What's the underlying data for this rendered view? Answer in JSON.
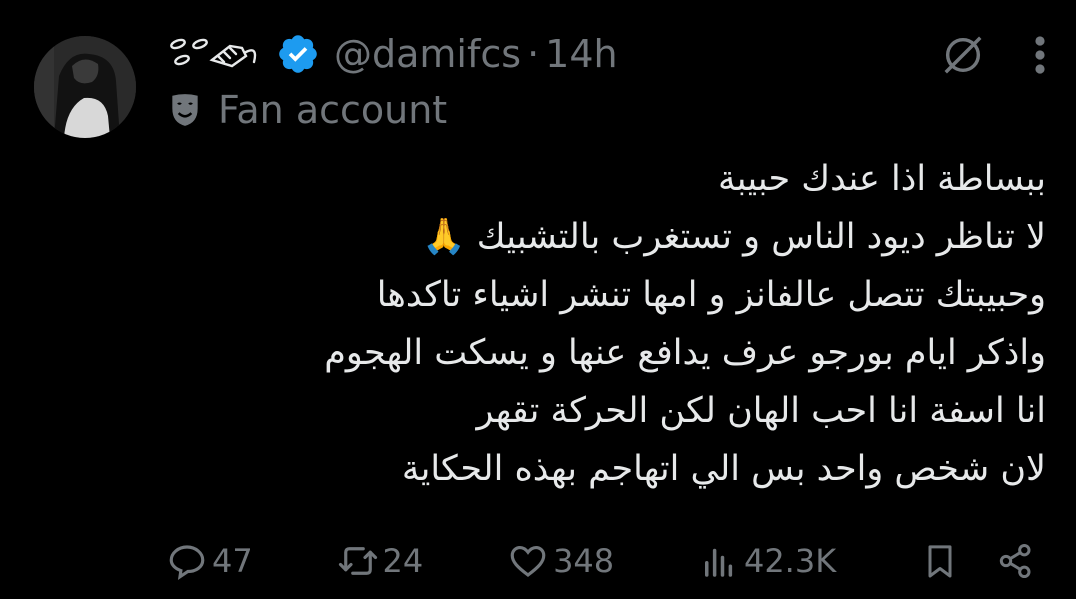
{
  "tweet": {
    "handle": "@damifcs",
    "separator": "·",
    "time": "14h",
    "label": "Fan account",
    "body_lines": [
      "ببساطة اذا عندك حبيبة",
      "لا تناظر ديود الناس و تستغرب بالتشبيك 🙏",
      "وحبيبتك تتصل عالفانز و امها تنشر اشياء تاكدها",
      "واذكر ايام بورجو عرف يدافع عنها و يسكت الهجوم",
      "انا اسفة انا احب الهان لكن الحركة تقهر",
      "لان شخص واحد بس الي اتهاجم بهذه الحكاية"
    ],
    "stats": {
      "replies": "47",
      "reposts": "24",
      "likes": "348",
      "views": "42.3K"
    }
  },
  "colors": {
    "background": "#000000",
    "text": "#e7e9ea",
    "muted": "#71767b",
    "verified": "#1d9bf0"
  },
  "icons": {
    "verified": "verified-badge-icon",
    "label": "theater-mask-icon",
    "grok": "grok-icon",
    "more": "more-icon",
    "reply": "reply-icon",
    "repost": "repost-icon",
    "like": "like-icon",
    "views": "views-icon",
    "bookmark": "bookmark-icon",
    "share": "share-icon"
  }
}
